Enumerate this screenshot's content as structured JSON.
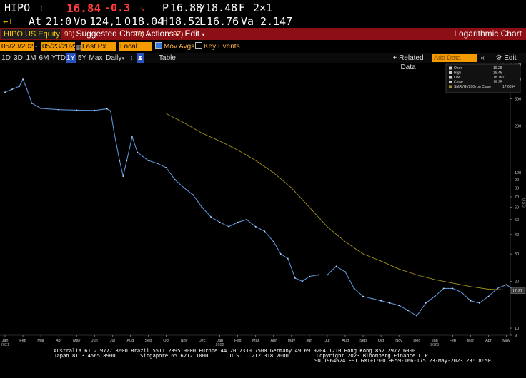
{
  "quote": {
    "ticker": "HIPO",
    "price": "16.84",
    "change": "-0.3",
    "prev_label": "P",
    "prev_value": "16.88",
    "bid_sep": "/",
    "ask_value": "18.48",
    "f_label": "F",
    "size": "2×1",
    "at_label": "At",
    "at_time": "21:0",
    "vol_label": "Vo",
    "volume": "124,1",
    "open_label": "O",
    "open_value": "18.04",
    "high_label": "H",
    "high_value": "18.52",
    "low_label": "L",
    "low_value": "16.76",
    "val_label": "Va",
    "value": "2.147"
  },
  "toolbar": {
    "security": "HIPO US Equity",
    "suggested_num": "98)",
    "suggested": "Suggested Charts",
    "actions_num": "96)",
    "actions": "Actions",
    "edit_num": "97)",
    "edit": "Edit",
    "chart_title": "Logarithmic Chart"
  },
  "settings": {
    "start_date": "05/23/2022",
    "end_date": "05/23/2023",
    "price_field": "Last Px",
    "currency": "Local CCY",
    "mov_avgs": "Mov Avgs",
    "key_events": "Key Events"
  },
  "periods": [
    "1D",
    "3D",
    "1M",
    "6M",
    "YTD",
    "1Y",
    "5Y",
    "Max"
  ],
  "selected_period": "1Y",
  "frequency": "Daily",
  "table_label": "Table",
  "related_data": "+ Related Data",
  "add_data_placeholder": "Add Data",
  "edit_chart": "Edit Chart",
  "footer": {
    "line1": "Australia 61 2 9777 8600 Brazil 5511 2395 9000 Europe 44 20 7330 7500 Germany 49 69 9204 1210 Hong Kong 852 2977 6000",
    "line2": "Japan 81 3 4565 8900        Singapore 65 6212 1000       U.S. 1 212 318 2000         Copyright 2023 Bloomberg Finance L.P.",
    "line3": "SN 1964624 EST  GMT+1:00 H959-166-175 23-May-2023 23:18:50"
  },
  "colors": {
    "price_line": "#5b8fd4",
    "sma_line": "#a0901e",
    "header_bar": "#8c0f16",
    "field_orange": "#f39a00",
    "change_red": "#ff3b3b"
  },
  "chart_data": {
    "type": "line",
    "scale": "log",
    "ylim": [
      9,
      500
    ],
    "yticks": [
      500,
      400,
      300,
      200,
      100,
      90,
      80,
      70,
      60,
      50,
      40,
      30,
      20,
      10,
      9
    ],
    "ylabel": "USD",
    "month_ticks": [
      "Jan",
      "Feb",
      "Mar",
      "Apr",
      "May",
      "Jun",
      "Jul",
      "Aug",
      "Sep",
      "Oct",
      "Nov",
      "Dec",
      "Jan",
      "Feb",
      "Mar",
      "Apr",
      "May",
      "Jun",
      "Jul",
      "Aug",
      "Sep",
      "Oct",
      "Nov",
      "Dec",
      "Jan",
      "Feb",
      "Mar",
      "Apr",
      "May"
    ],
    "year_labels": [
      "2021",
      "2022",
      "2023"
    ],
    "legend": [
      {
        "name": "Open",
        "value": "19.28"
      },
      {
        "name": "High",
        "value": "19.46"
      },
      {
        "name": "Low",
        "value": "18.7601"
      },
      {
        "name": "Close",
        "value": "19.25"
      },
      {
        "name": "SMAVG (200)  on Close",
        "value": "17.6094"
      }
    ],
    "last_price_label": "17.37",
    "series": [
      {
        "name": "Close",
        "points": [
          [
            0,
            330
          ],
          [
            0.4,
            345
          ],
          [
            0.8,
            360
          ],
          [
            1.0,
            400
          ],
          [
            1.2,
            350
          ],
          [
            1.5,
            280
          ],
          [
            2,
            260
          ],
          [
            3,
            255
          ],
          [
            4,
            253
          ],
          [
            5,
            252
          ],
          [
            5.7,
            258
          ],
          [
            5.9,
            250
          ],
          [
            6.1,
            180
          ],
          [
            6.4,
            120
          ],
          [
            6.6,
            95
          ],
          [
            6.8,
            120
          ],
          [
            7.1,
            170
          ],
          [
            7.4,
            135
          ],
          [
            8,
            120
          ],
          [
            8.5,
            115
          ],
          [
            9,
            108
          ],
          [
            9.5,
            90
          ],
          [
            10,
            80
          ],
          [
            10.5,
            72
          ],
          [
            11,
            60
          ],
          [
            11.5,
            52
          ],
          [
            12,
            48
          ],
          [
            12.5,
            45
          ],
          [
            13,
            48
          ],
          [
            13.5,
            50
          ],
          [
            14,
            45
          ],
          [
            14.5,
            42
          ],
          [
            15,
            36
          ],
          [
            15.4,
            30
          ],
          [
            15.8,
            28
          ],
          [
            16.2,
            21
          ],
          [
            16.6,
            20
          ],
          [
            17,
            21.5
          ],
          [
            17.5,
            22
          ],
          [
            18,
            22
          ],
          [
            18.5,
            25
          ],
          [
            19,
            23
          ],
          [
            19.5,
            18
          ],
          [
            20,
            16
          ],
          [
            20.5,
            15.5
          ],
          [
            21,
            15
          ],
          [
            21.5,
            14.5
          ],
          [
            22,
            14
          ],
          [
            22.5,
            13
          ],
          [
            23,
            12
          ],
          [
            23.5,
            14.5
          ],
          [
            24,
            16
          ],
          [
            24.5,
            18
          ],
          [
            25,
            18
          ],
          [
            25.5,
            17
          ],
          [
            26,
            15
          ],
          [
            26.5,
            14.5
          ],
          [
            27,
            16
          ],
          [
            27.5,
            18
          ],
          [
            28,
            19
          ],
          [
            28.5,
            17.4
          ]
        ]
      },
      {
        "name": "SMAVG (200)",
        "points": [
          [
            9,
            240
          ],
          [
            10,
            210
          ],
          [
            11,
            180
          ],
          [
            12,
            160
          ],
          [
            13,
            140
          ],
          [
            14,
            120
          ],
          [
            15,
            100
          ],
          [
            16,
            80
          ],
          [
            17,
            60
          ],
          [
            18,
            45
          ],
          [
            19,
            36
          ],
          [
            20,
            30
          ],
          [
            21,
            27
          ],
          [
            22,
            24
          ],
          [
            23,
            22
          ],
          [
            24,
            20.5
          ],
          [
            25,
            19.5
          ],
          [
            26,
            18.5
          ],
          [
            27,
            17.8
          ],
          [
            28,
            17.6
          ],
          [
            28.5,
            17.6
          ]
        ]
      }
    ]
  }
}
